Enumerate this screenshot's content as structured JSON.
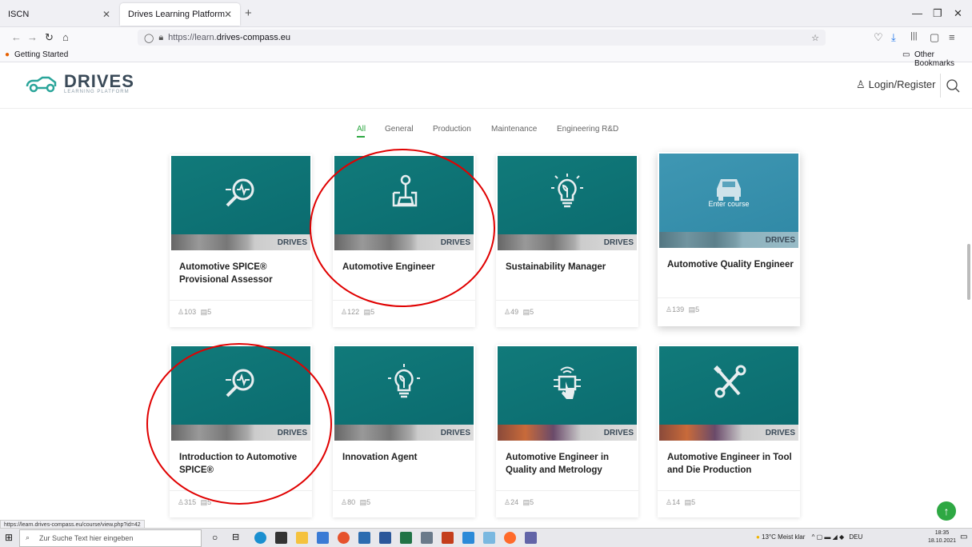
{
  "browser": {
    "tabs": [
      {
        "label": "ISCN"
      },
      {
        "label": "Drives Learning Platform"
      }
    ],
    "url_prefix": "https://learn.",
    "url_domain": "drives-compass.eu",
    "bookmark_getting_started": "Getting Started",
    "bookmark_other": "Other Bookmarks"
  },
  "header": {
    "logo_word": "DRIVES",
    "logo_sub": "LEARNING PLATFORM",
    "login_label": "Login/Register"
  },
  "filters": [
    {
      "label": "All",
      "active": true
    },
    {
      "label": "General"
    },
    {
      "label": "Production"
    },
    {
      "label": "Maintenance"
    },
    {
      "label": "Engineering R&D"
    }
  ],
  "courses": [
    {
      "title": "Automotive SPICE® Provisional Assessor",
      "students": "103",
      "lessons": "5",
      "icon": "magnifier-pulse-icon"
    },
    {
      "title": "Automotive Engineer",
      "students": "122",
      "lessons": "5",
      "icon": "gear-shift-icon"
    },
    {
      "title": "Sustainability Manager",
      "students": "49",
      "lessons": "5",
      "icon": "lightbulb-leaf-icon"
    },
    {
      "title": "Automotive Quality Engineer",
      "students": "139",
      "lessons": "5",
      "icon": "car-icon",
      "overlay": "Enter course"
    },
    {
      "title": "Introduction to Automotive SPICE®",
      "students": "315",
      "lessons": "5",
      "icon": "magnifier-pulse-icon"
    },
    {
      "title": "Innovation Agent",
      "students": "80",
      "lessons": "5",
      "icon": "lightbulb-leaf-icon"
    },
    {
      "title": "Automotive Engineer in Quality and Metrology",
      "students": "24",
      "lessons": "5",
      "icon": "touch-chip-icon"
    },
    {
      "title": "Automotive Engineer in Tool and Die Production",
      "students": "14",
      "lessons": "5",
      "icon": "tools-icon"
    }
  ],
  "card_brand": "DRIVES",
  "status_url": "https://learn.drives-compass.eu/course/view.php?id=42",
  "taskbar": {
    "search_placeholder": "Zur Suche Text hier eingeben",
    "weather": "13°C Meist klar",
    "lang": "DEU",
    "time": "18:35",
    "date": "18.10.2021"
  },
  "colors": {
    "accent": "#2ea843",
    "card_bg": "#117a7a",
    "annotation": "#e00000"
  }
}
